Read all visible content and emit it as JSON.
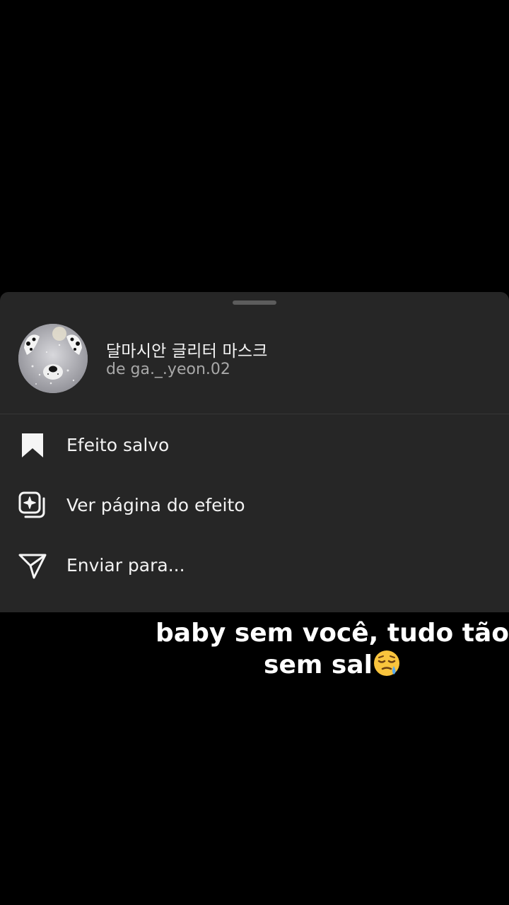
{
  "effect": {
    "title": "달마시안 글리터 마스크",
    "author": "de ga._.yeon.02"
  },
  "menu": [
    {
      "label": "Efeito salvo",
      "icon": "bookmark-filled-icon"
    },
    {
      "label": "Ver página do efeito",
      "icon": "effect-page-icon"
    },
    {
      "label": "Enviar para...",
      "icon": "send-icon"
    }
  ],
  "caption": {
    "line1": "baby sem você, tudo tão",
    "line2": "sem sal",
    "emoji": "sleepy-face-emoji"
  },
  "colors": {
    "background": "#000000",
    "sheet": "#262626",
    "text": "#f2f2f2",
    "muted": "#a8a8a8"
  }
}
